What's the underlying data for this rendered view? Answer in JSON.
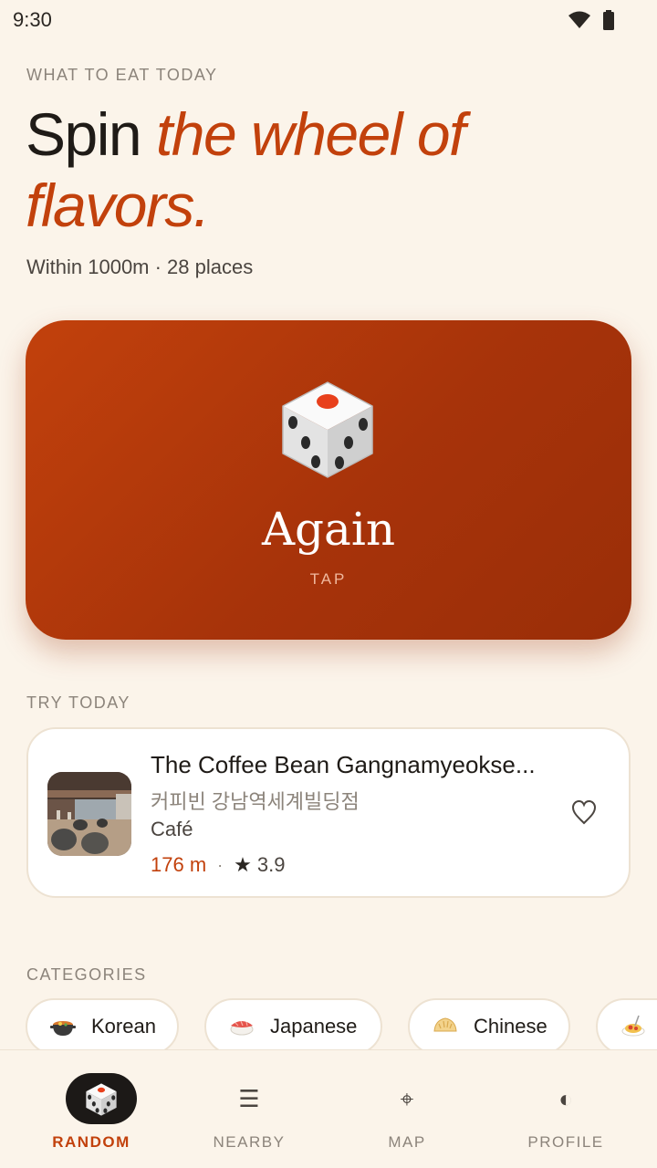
{
  "status_bar": {
    "time": "9:30",
    "icons": [
      "wifi-icon",
      "battery-icon"
    ]
  },
  "header": {
    "eyebrow": "WHAT TO EAT TODAY",
    "title_plain": "Spin",
    "title_accent": "the wheel of flavors.",
    "subtitle": "Within 1000m · 28 places"
  },
  "spin": {
    "icon": "dice-icon",
    "label": "Again",
    "sublabel": "TAP"
  },
  "try_today": {
    "section_label": "TRY TODAY",
    "place": {
      "name": "The Coffee Bean Gangnamyeokse...",
      "local_name": "커피빈 강남역세계빌딩점",
      "category": "Café",
      "distance": "176 m",
      "separator": "·",
      "rating_icon": "★",
      "rating": "3.9",
      "favorite_icon": "heart-outline-icon"
    }
  },
  "categories": {
    "section_label": "CATEGORIES",
    "items": [
      {
        "label": "Korean",
        "icon": "hot-pot-icon"
      },
      {
        "label": "Japanese",
        "icon": "sushi-icon"
      },
      {
        "label": "Chinese",
        "icon": "dumpling-icon"
      },
      {
        "label": "",
        "icon": "spaghetti-icon"
      }
    ]
  },
  "bottom_nav": {
    "items": [
      {
        "label": "RANDOM",
        "icon": "dice-icon",
        "active": true
      },
      {
        "label": "NEARBY",
        "icon": "☰",
        "active": false
      },
      {
        "label": "MAP",
        "icon": "⌖",
        "active": false
      },
      {
        "label": "PROFILE",
        "icon": "◐",
        "active": false
      }
    ]
  },
  "colors": {
    "background": "#FBF4EA",
    "accent": "#C2410C",
    "card_gradient_start": "#C2410C",
    "card_gradient_end": "#9A2E08",
    "muted_text": "#8C847B"
  }
}
